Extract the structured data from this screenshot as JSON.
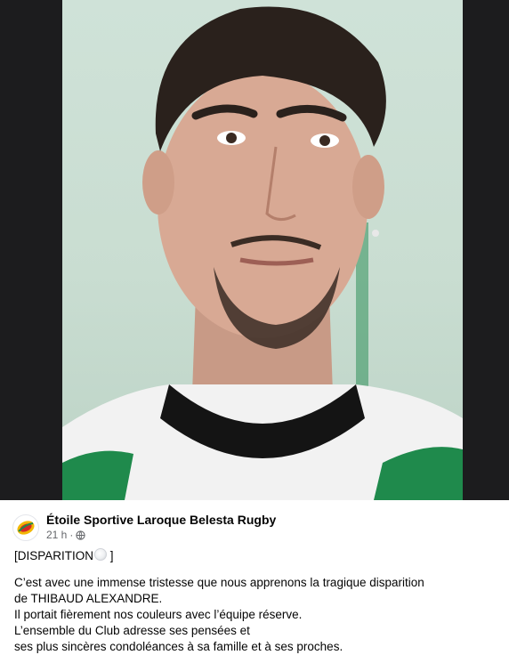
{
  "post": {
    "page_name": "Étoile Sportive Laroque Belesta Rugby",
    "time": "21 h",
    "separator": "·",
    "audience_icon": "globe-icon",
    "title_prefix": "[DISPARITION",
    "title_emoji": "rugby-ball-emoji",
    "title_suffix": " ]",
    "lines": [
      "C’est avec une immense tristesse que nous apprenons la tragique disparition",
      "de THIBAUD ALEXANDRE.",
      "Il portait fièrement nos couleurs avec l’équipe réserve.",
      "L’ensemble du Club adresse ses pensées et",
      "ses plus sincères condoléances à sa famille et à ses proches."
    ]
  },
  "colors": {
    "text": "#050505",
    "secondary_text": "#65676b",
    "jersey_green": "#1f8a4c",
    "jersey_white": "#f5f5f5"
  }
}
